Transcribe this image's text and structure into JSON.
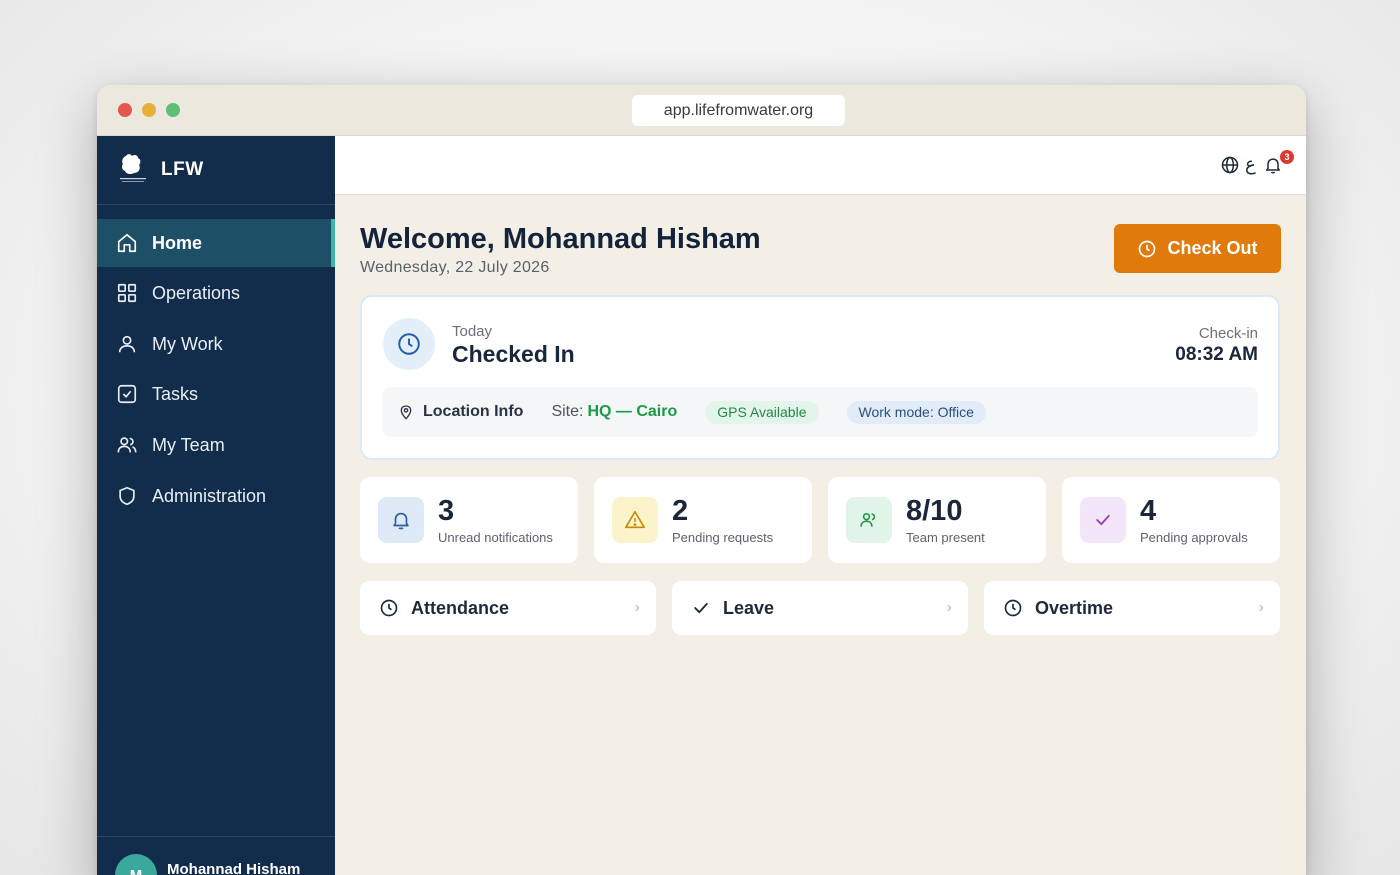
{
  "browser": {
    "url": "app.lifefromwater.org"
  },
  "sidebar": {
    "brand": "LFW",
    "items": [
      {
        "label": "Home",
        "icon": "home-icon",
        "active": true
      },
      {
        "label": "Operations",
        "icon": "grid-icon",
        "active": false
      },
      {
        "label": "My Work",
        "icon": "user-icon",
        "active": false
      },
      {
        "label": "Tasks",
        "icon": "checkbox-icon",
        "active": false
      },
      {
        "label": "My Team",
        "icon": "team-icon",
        "active": false
      },
      {
        "label": "Administration",
        "icon": "shield-icon",
        "active": false
      }
    ],
    "user": {
      "initial": "M",
      "name": "Mohannad Hisham"
    }
  },
  "topbar": {
    "language_glyph": "ع",
    "notification_count": "3"
  },
  "main": {
    "welcome": "Welcome, Mohannad Hisham",
    "date": "Wednesday, 22 July 2026",
    "checkout_label": "Check Out",
    "status": {
      "today_label": "Today",
      "state": "Checked In",
      "checkin_label": "Check-in",
      "checkin_time": "08:32 AM",
      "location_title": "Location Info",
      "site_label": "Site:",
      "site_value": "HQ — Cairo",
      "gps_badge": "GPS Available",
      "mode_badge": "Work mode: Office"
    },
    "stats": [
      {
        "value": "3",
        "label": "Unread notifications",
        "icon": "bell-icon"
      },
      {
        "value": "2",
        "label": "Pending requests",
        "icon": "warning-icon"
      },
      {
        "value": "8/10",
        "label": "Team present",
        "icon": "team-icon"
      },
      {
        "value": "4",
        "label": "Pending approvals",
        "icon": "check-icon"
      }
    ],
    "quick_links": [
      {
        "label": "Attendance",
        "icon": "clock-icon"
      },
      {
        "label": "Leave",
        "icon": "check-icon"
      },
      {
        "label": "Overtime",
        "icon": "clock-icon"
      }
    ]
  },
  "colors": {
    "sidebar_bg": "#122d4c",
    "active_item_bg": "#1d5067",
    "accent_teal": "#3eb5a6",
    "checkout_orange": "#e07a0b",
    "site_green": "#1a9a46",
    "badge_red": "#d83a32"
  }
}
